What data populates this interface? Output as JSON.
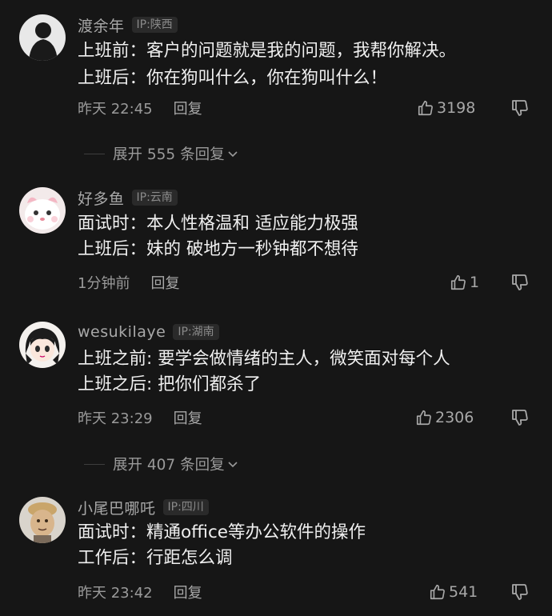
{
  "comments": [
    {
      "username": "渡余年",
      "ip": "IP:陕西",
      "lines": [
        "上班前：客户的问题就是我的问题，我帮你解决。",
        " 上班后：你在狗叫什么，你在狗叫什么！"
      ],
      "time": "昨天 22:45",
      "reply_label": "回复",
      "likes": "3198"
    },
    {
      "username": "好多鱼",
      "ip": "IP:云南",
      "lines": [
        "面试时：本人性格温和 适应能力极强",
        "上班后：妹的 破地方一秒钟都不想待"
      ],
      "time": "1分钟前",
      "reply_label": "回复",
      "likes": "1"
    },
    {
      "username": "wesukilaye",
      "ip": "IP:湖南",
      "lines": [
        "上班之前: 要学会做情绪的主人，微笑面对每个人",
        "上班之后: 把你们都杀了"
      ],
      "time": "昨天 23:29",
      "reply_label": "回复",
      "likes": "2306"
    },
    {
      "username": "小尾巴哪吒",
      "ip": "IP:四川",
      "lines": [
        "面试时：精通office等办公软件的操作",
        "工作后：行距怎么调"
      ],
      "time": "昨天 23:42",
      "reply_label": "回复",
      "likes": "541"
    }
  ],
  "expand_1": "展开 555 条回复",
  "expand_2": "展开 407 条回复",
  "colors": {
    "background": "#161616",
    "text_primary": "#f0f0f0",
    "text_secondary": "#9a9a9a"
  },
  "icons": {
    "like": "thumbs-up-icon",
    "dislike": "thumbs-down-icon",
    "expand": "chevron-down-icon"
  }
}
